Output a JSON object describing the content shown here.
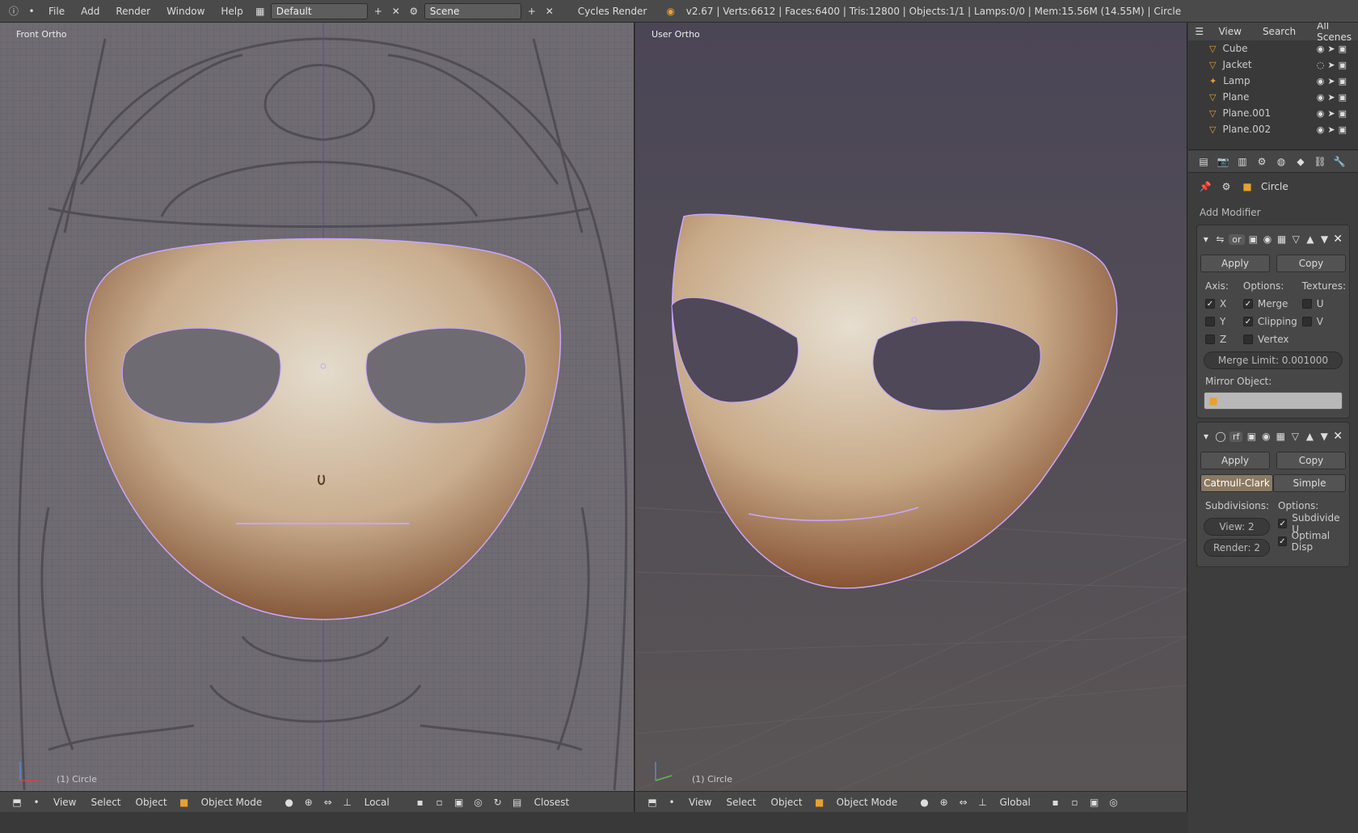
{
  "topbar": {
    "menus": [
      "File",
      "Add",
      "Render",
      "Window",
      "Help"
    ],
    "layout": "Default",
    "scene": "Scene",
    "engine": "Cycles Render",
    "stats": "v2.67 | Verts:6612 | Faces:6400 | Tris:12800 | Objects:1/1 | Lamps:0/0 | Mem:15.56M (14.55M) | Circle"
  },
  "left_view": {
    "label": "Front Ortho",
    "object": "(1) Circle",
    "menus": [
      "View",
      "Select",
      "Object"
    ],
    "mode": "Object Mode",
    "pivot": "Local",
    "extra": "Closest"
  },
  "right_view": {
    "label": "User Ortho",
    "object": "(1) Circle",
    "menus": [
      "View",
      "Select",
      "Object"
    ],
    "mode": "Object Mode",
    "pivot": "Global"
  },
  "outliner": {
    "header": [
      "View",
      "Search",
      "All Scenes"
    ],
    "items": [
      {
        "name": "Cube"
      },
      {
        "name": "Jacket"
      },
      {
        "name": "Lamp"
      },
      {
        "name": "Plane"
      },
      {
        "name": "Plane.001"
      },
      {
        "name": "Plane.002"
      }
    ]
  },
  "properties": {
    "context": "Circle",
    "add_modifier": "Add Modifier",
    "mirror": {
      "name": "or",
      "apply": "Apply",
      "copy": "Copy",
      "axis_header": "Axis:",
      "options_header": "Options:",
      "textures_header": "Textures:",
      "x": "X",
      "y": "Y",
      "z": "Z",
      "merge": "Merge",
      "clipping": "Clipping",
      "vertex": "Vertex",
      "u": "U",
      "v": "V",
      "merge_limit": "Merge Limit: 0.001000",
      "mirror_object": "Mirror Object:"
    },
    "subsurf": {
      "name": "rf",
      "apply": "Apply",
      "copy": "Copy",
      "catmull": "Catmull-Clark",
      "simple": "Simple",
      "subdiv_header": "Subdivisions:",
      "options_header": "Options:",
      "view": "View: 2",
      "render": "Render: 2",
      "subdivide_uv": "Subdivide U",
      "optimal": "Optimal Disp"
    }
  },
  "colors": {
    "accent": "#e8a030",
    "mask": "#d8c8b0",
    "selection": "#c9a6ff"
  }
}
